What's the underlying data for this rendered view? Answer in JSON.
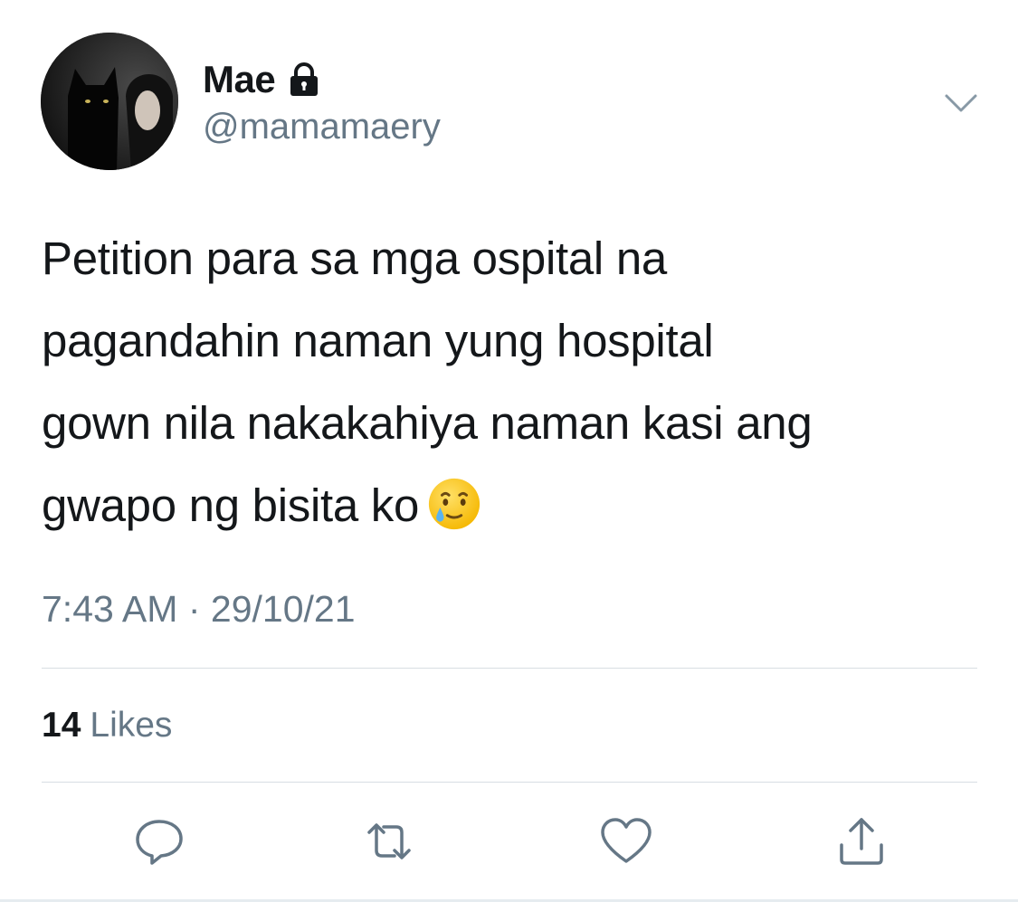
{
  "author": {
    "display_name": "Mae",
    "handle": "@mamamaery",
    "protected": true
  },
  "tweet": {
    "lines": [
      "Petition para sa mga ospital na",
      "pagandahin naman yung hospital",
      "gown nila nakakahiya naman kasi ang",
      "gwapo ng bisita ko"
    ],
    "emoji": "smiling-face-with-tear"
  },
  "meta": {
    "time": "7:43 AM",
    "separator": "·",
    "date": "29/10/21"
  },
  "stats": {
    "likes_count": "14",
    "likes_label": "Likes"
  },
  "actions": [
    {
      "name": "reply-icon"
    },
    {
      "name": "retweet-icon"
    },
    {
      "name": "like-icon"
    },
    {
      "name": "share-icon"
    }
  ],
  "colors": {
    "text": "#14171a",
    "secondary": "#657786",
    "divider": "#d8dee3"
  }
}
